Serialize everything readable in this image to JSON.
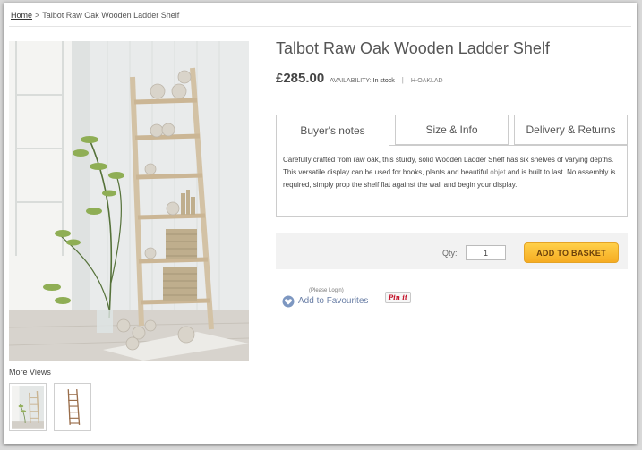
{
  "breadcrumb": {
    "home_label": "Home",
    "separator": ">",
    "current": "Talbot Raw Oak Wooden Ladder Shelf"
  },
  "product": {
    "title": "Talbot Raw Oak Wooden Ladder Shelf",
    "price": "£285.00",
    "availability_label": "AVAILABILITY:",
    "availability_value": "In stock",
    "separator": "|",
    "sku": "H-OAKLAD"
  },
  "gallery": {
    "more_views_label": "More Views",
    "main_image_icon": "ladder-shelf-photo",
    "thumbnails": [
      "room-photo-thumbnail",
      "ladder-shelf-thumbnail"
    ]
  },
  "tabs": [
    {
      "label": "Buyer's notes",
      "active": true
    },
    {
      "label": "Size & Info",
      "active": false
    },
    {
      "label": "Delivery & Returns",
      "active": false
    }
  ],
  "description": {
    "part1": "Carefully crafted from raw oak, this sturdy, solid Wooden Ladder Shelf has six shelves of varying depths. This versatile display can be used for books, plants and beautiful ",
    "link": "objet",
    "part2": " and is built to last. No assembly is required, simply prop the shelf flat against the wall and begin your display."
  },
  "basket": {
    "qty_label": "Qty:",
    "qty_value": "1",
    "add_button": "ADD TO BASKET"
  },
  "favourites": {
    "login_note": "(Please Login)",
    "add_label": "Add to Favourites",
    "icon": "heart-icon"
  },
  "pinterest": {
    "label": "Pin it"
  },
  "colors": {
    "button_gradient_top": "#ffd04a",
    "button_gradient_bottom": "#f6ac22",
    "link_blue": "#6a7fa6",
    "pinterest_red": "#c4152c"
  }
}
